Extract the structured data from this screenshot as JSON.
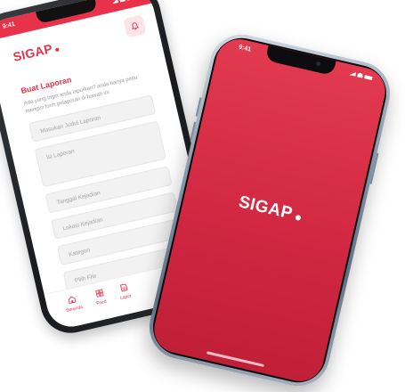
{
  "back_phone": {
    "status_time": "9:41",
    "logo": "SIGAP",
    "form_title": "Buat Laporan",
    "form_description": "Ada yang ingin anda laporkan? anda hanya perlu mengisi form pelaporan di bawah ini",
    "fields": {
      "title_placeholder": "Masukan Judul Laporan",
      "report_placeholder": "Isi Laporan",
      "date_placeholder": "Tanggal Kejadian",
      "location_placeholder": "Lokasi Kejadian",
      "category_placeholder": "Kategori",
      "file_placeholder": "Pilih File"
    },
    "nav": {
      "home_label": "Beranda",
      "feed_label": "Feed",
      "report_label": "Lapor"
    }
  },
  "front_phone": {
    "status_time": "9:41",
    "logo": "SIGAP"
  },
  "colors": {
    "brand": "#e8324a",
    "brand_dark": "#c01f38",
    "field_bg": "#f2f2f2"
  }
}
